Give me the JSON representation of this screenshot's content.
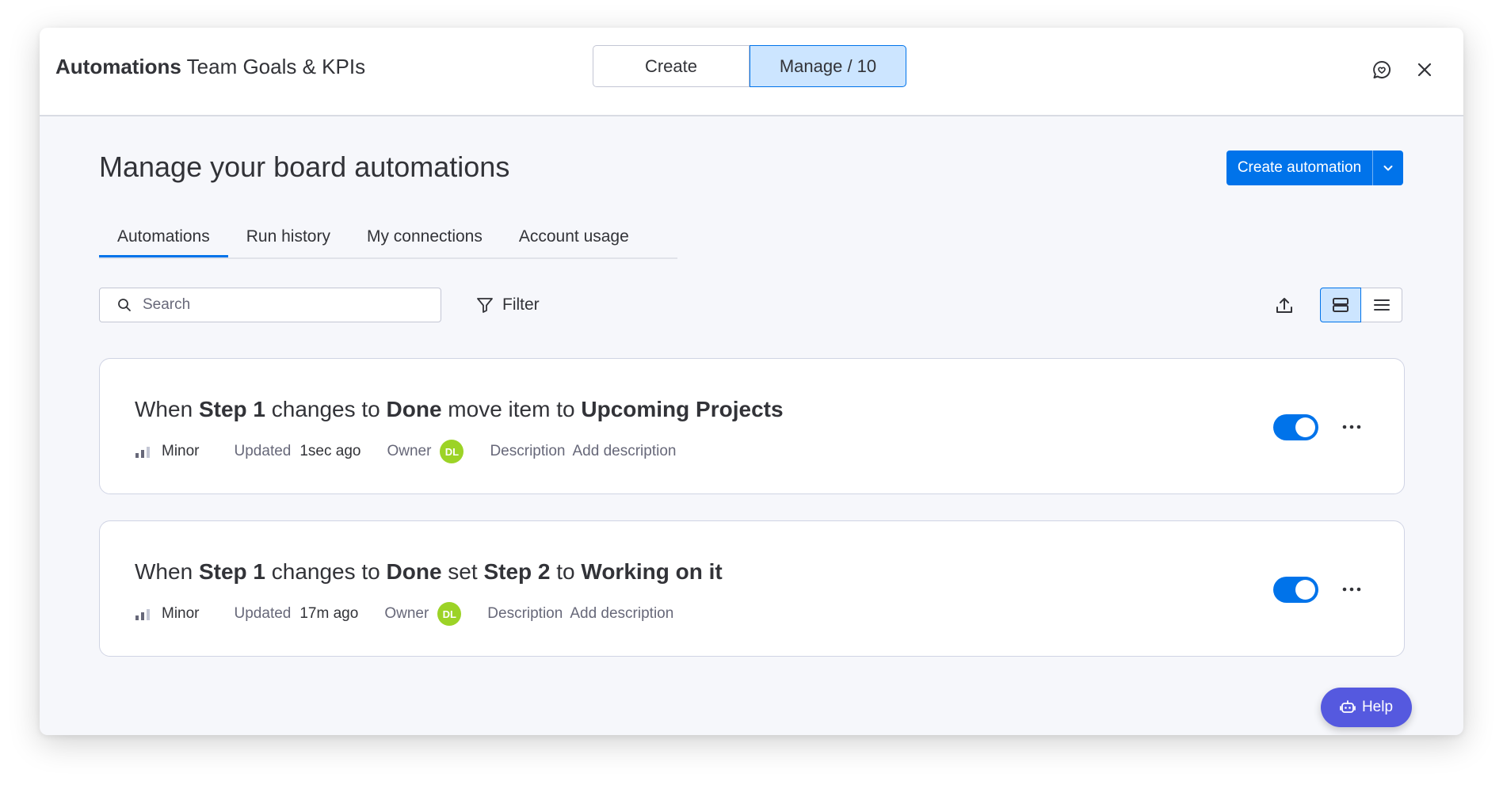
{
  "header": {
    "title_bold": "Automations",
    "title_rest": "Team Goals & KPIs",
    "segments": [
      "Create",
      "Manage / 10"
    ],
    "icons": [
      "feedback-icon",
      "close-icon"
    ]
  },
  "page": {
    "title": "Manage your board automations",
    "create_button": "Create automation"
  },
  "tabs": [
    {
      "label": "Automations",
      "active": true
    },
    {
      "label": "Run history",
      "active": false
    },
    {
      "label": "My connections",
      "active": false
    },
    {
      "label": "Account usage",
      "active": false
    }
  ],
  "toolbar": {
    "search_placeholder": "Search",
    "filter_label": "Filter"
  },
  "automations": [
    {
      "parts": [
        {
          "t": "When ",
          "b": false
        },
        {
          "t": "Step 1",
          "b": true
        },
        {
          "t": " changes to ",
          "b": false
        },
        {
          "t": "Done",
          "b": true
        },
        {
          "t": " move item to ",
          "b": false
        },
        {
          "t": "Upcoming Projects",
          "b": true
        }
      ],
      "priority": "Minor",
      "updated_label": "Updated",
      "updated_value": "1sec ago",
      "owner_label": "Owner",
      "owner_initials": "DL",
      "description_label": "Description",
      "description_value": "Add description",
      "enabled": true
    },
    {
      "parts": [
        {
          "t": "When ",
          "b": false
        },
        {
          "t": "Step 1",
          "b": true
        },
        {
          "t": " changes to ",
          "b": false
        },
        {
          "t": "Done",
          "b": true
        },
        {
          "t": " set ",
          "b": false
        },
        {
          "t": "Step 2",
          "b": true
        },
        {
          "t": " to ",
          "b": false
        },
        {
          "t": "Working on it",
          "b": true
        }
      ],
      "priority": "Minor",
      "updated_label": "Updated",
      "updated_value": "17m ago",
      "owner_label": "Owner",
      "owner_initials": "DL",
      "description_label": "Description",
      "description_value": "Add description",
      "enabled": true
    }
  ],
  "help_label": "Help",
  "colors": {
    "primary": "#0073ea",
    "selected_bg": "#cce5ff",
    "avatar": "#9cd326",
    "help": "#5559df"
  }
}
